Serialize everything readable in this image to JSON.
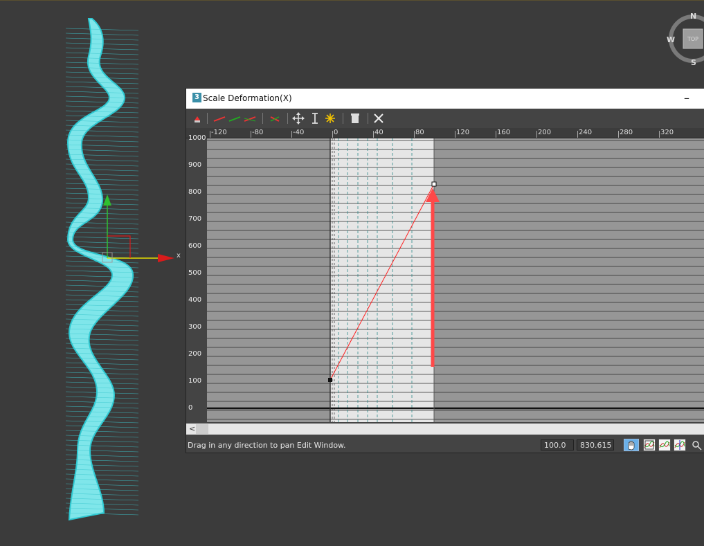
{
  "dialog": {
    "title": "Scale Deformation(X)",
    "app_badge": "3",
    "minimize_label": "–"
  },
  "ruler": {
    "labels": [
      "-120",
      "-80",
      "-40",
      "0",
      "40",
      "80",
      "120",
      "160",
      "200",
      "240",
      "280",
      "320"
    ]
  },
  "graph": {
    "y_labels": [
      "1000",
      "900",
      "800",
      "700",
      "600",
      "500",
      "400",
      "300",
      "200",
      "100",
      "0"
    ]
  },
  "status": {
    "message": "Drag in any direction to pan Edit Window.",
    "field_position": "100.0",
    "field_value": "830.615"
  },
  "viewcube": {
    "north": "N",
    "west": "W",
    "south": "S",
    "face": "TOP"
  },
  "gizmo": {
    "x_label": "x"
  },
  "colors": {
    "curve": "#ff2020",
    "annotation_arrow": "#ff4848",
    "mesh": "#7fe6ea",
    "mesh_edge": "#2ec9d2"
  }
}
